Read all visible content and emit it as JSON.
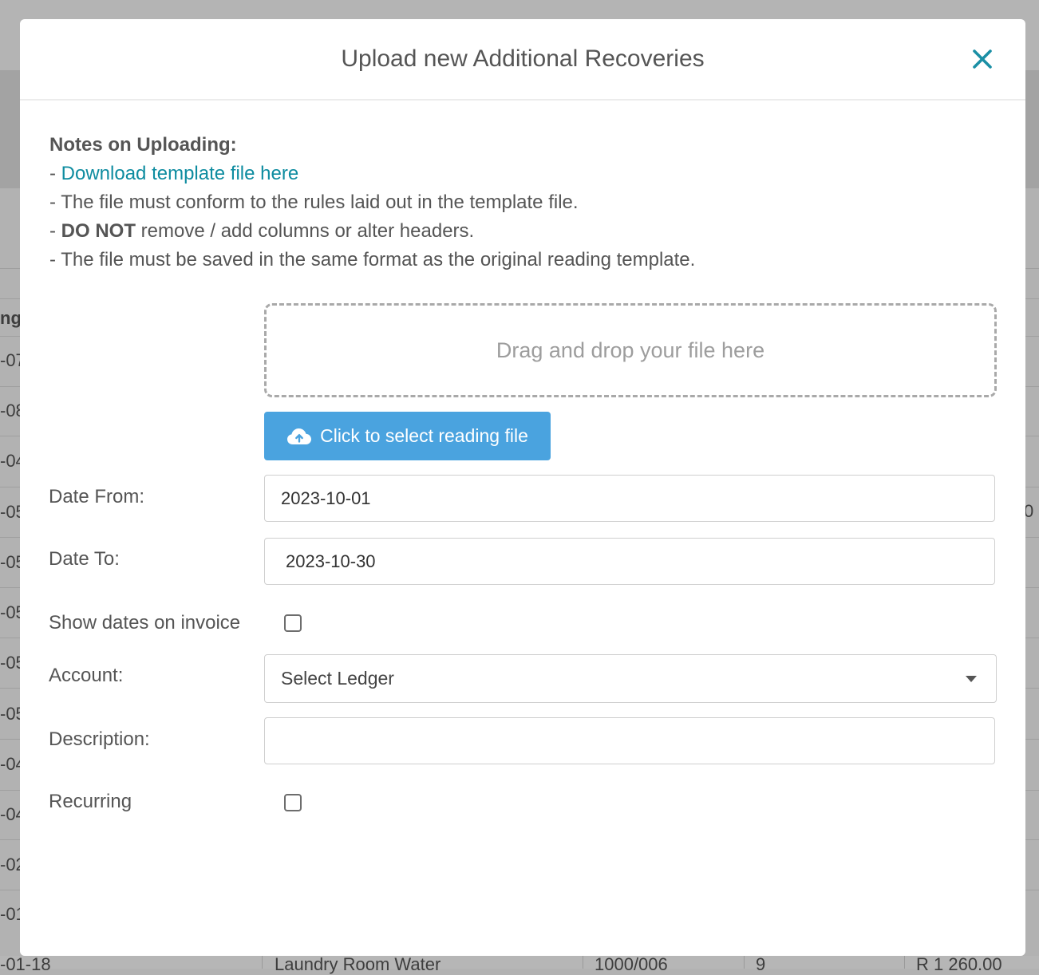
{
  "background": {
    "column_header_fragment": "ng",
    "row_fragments": [
      "-07",
      "-08",
      "-04",
      "-05",
      "-05",
      "-05",
      "-05",
      "-05",
      "-04",
      "-04",
      "-02",
      "-01"
    ],
    "right_fragment": "0",
    "bottom_row": {
      "date": "-01-18",
      "description": "Laundry Room Water",
      "code": "1000/006",
      "quantity": "9",
      "amount": "R 1 260.00"
    }
  },
  "modal": {
    "title": "Upload new Additional Recoveries",
    "close_icon": "close-icon",
    "notes": {
      "heading": "Notes on Uploading:",
      "dash": "- ",
      "download_link": "Download template file here",
      "rule_1": "- The file must conform to the rules laid out in the template file.",
      "rule_2_bold": "DO NOT",
      "rule_2_rest": " remove / add columns or alter headers.",
      "rule_3": "- The file must be saved in the same format as the original reading template."
    },
    "dropzone_text": "Drag and drop your file here",
    "select_file_button": {
      "label": "Click to select reading file",
      "icon": "cloud-upload-icon"
    },
    "form": {
      "date_from": {
        "label": "Date From:",
        "value": "2023-10-01"
      },
      "date_to": {
        "label": "Date To:",
        "value": "2023-10-30"
      },
      "show_dates": {
        "label": "Show dates on invoice",
        "checked": false
      },
      "account": {
        "label": "Account:",
        "selected": "Select Ledger",
        "icon": "caret-down-icon"
      },
      "description": {
        "label": "Description:",
        "value": ""
      },
      "recurring": {
        "label": "Recurring",
        "checked": false
      }
    }
  },
  "colors": {
    "accent_link": "#0e8ca0",
    "button_blue": "#4aa3df",
    "close_icon": "#1a8fa5"
  }
}
